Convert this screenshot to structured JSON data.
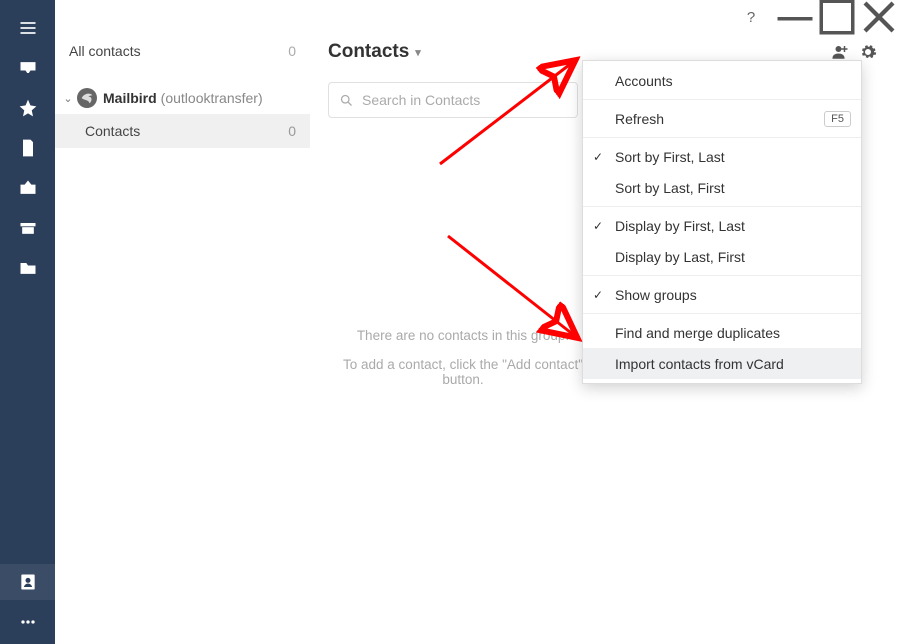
{
  "titlebar": {
    "help": "?"
  },
  "sidebar": {
    "all_contacts": "All contacts",
    "all_count": "0",
    "account_name": "Mailbird",
    "account_sub": "(outlooktransfer)",
    "contacts_label": "Contacts",
    "contacts_count": "0"
  },
  "main": {
    "title": "Contacts",
    "search_placeholder": "Search in Contacts",
    "empty_line1": "There are no contacts in this group.",
    "empty_line2": "To add a contact, click the \"Add contact\" button."
  },
  "menu": {
    "accounts": "Accounts",
    "refresh": "Refresh",
    "refresh_key": "F5",
    "sort_first_last": "Sort by First, Last",
    "sort_last_first": "Sort by Last, First",
    "display_first_last": "Display by First, Last",
    "display_last_first": "Display by Last, First",
    "show_groups": "Show groups",
    "find_merge": "Find and merge duplicates",
    "import_vcard": "Import contacts from vCard"
  }
}
